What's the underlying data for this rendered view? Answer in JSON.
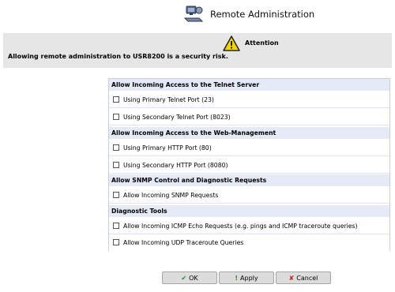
{
  "header": {
    "title": "Remote Administration",
    "icon": "remote-admin-icon"
  },
  "attention": {
    "title": "Attention",
    "message": "Allowing remote administration to USR8200 is a security risk.",
    "icon": "warning-icon"
  },
  "sections": [
    {
      "title": "Allow Incoming Access to the Telnet Server",
      "options": [
        {
          "label": "Using Primary Telnet Port (23)",
          "checked": false
        },
        {
          "label": "Using Secondary Telnet Port (8023)",
          "checked": false
        }
      ]
    },
    {
      "title": "Allow Incoming Access to the Web-Management",
      "options": [
        {
          "label": "Using Primary HTTP Port (80)",
          "checked": false
        },
        {
          "label": "Using Secondary HTTP Port (8080)",
          "checked": false
        }
      ]
    },
    {
      "title": "Allow SNMP Control and Diagnostic Requests",
      "options": [
        {
          "label": "Allow Incoming SNMP Requests",
          "checked": false
        }
      ]
    },
    {
      "title": "Diagnostic Tools",
      "options": [
        {
          "label": "Allow Incoming ICMP Echo Requests (e.g. pings and ICMP traceroute queries)",
          "checked": false
        },
        {
          "label": "Allow Incoming UDP Traceroute Queries",
          "checked": false
        }
      ]
    }
  ],
  "buttons": {
    "ok": {
      "label": "OK",
      "icon": "check-icon",
      "color": "#2a8a2a"
    },
    "apply": {
      "label": "Apply",
      "icon": "exclamation-icon",
      "color": "#2a8a2a"
    },
    "cancel": {
      "label": "Cancel",
      "icon": "x-icon",
      "color": "#c02020"
    }
  }
}
